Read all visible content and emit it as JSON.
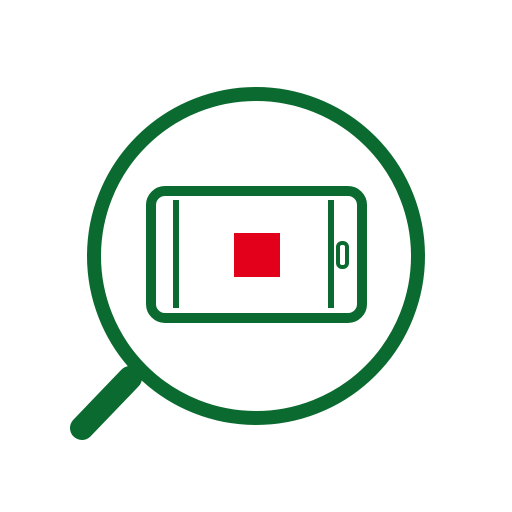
{
  "icon": {
    "name": "magnifier-search-phone-icon",
    "elements": [
      "magnifying-glass-icon",
      "smartphone-landscape-icon",
      "red-square-icon"
    ]
  },
  "colors": {
    "background": "#ffffff",
    "stroke_green": "#0b6a2f",
    "accent_red": "#e3001b"
  }
}
